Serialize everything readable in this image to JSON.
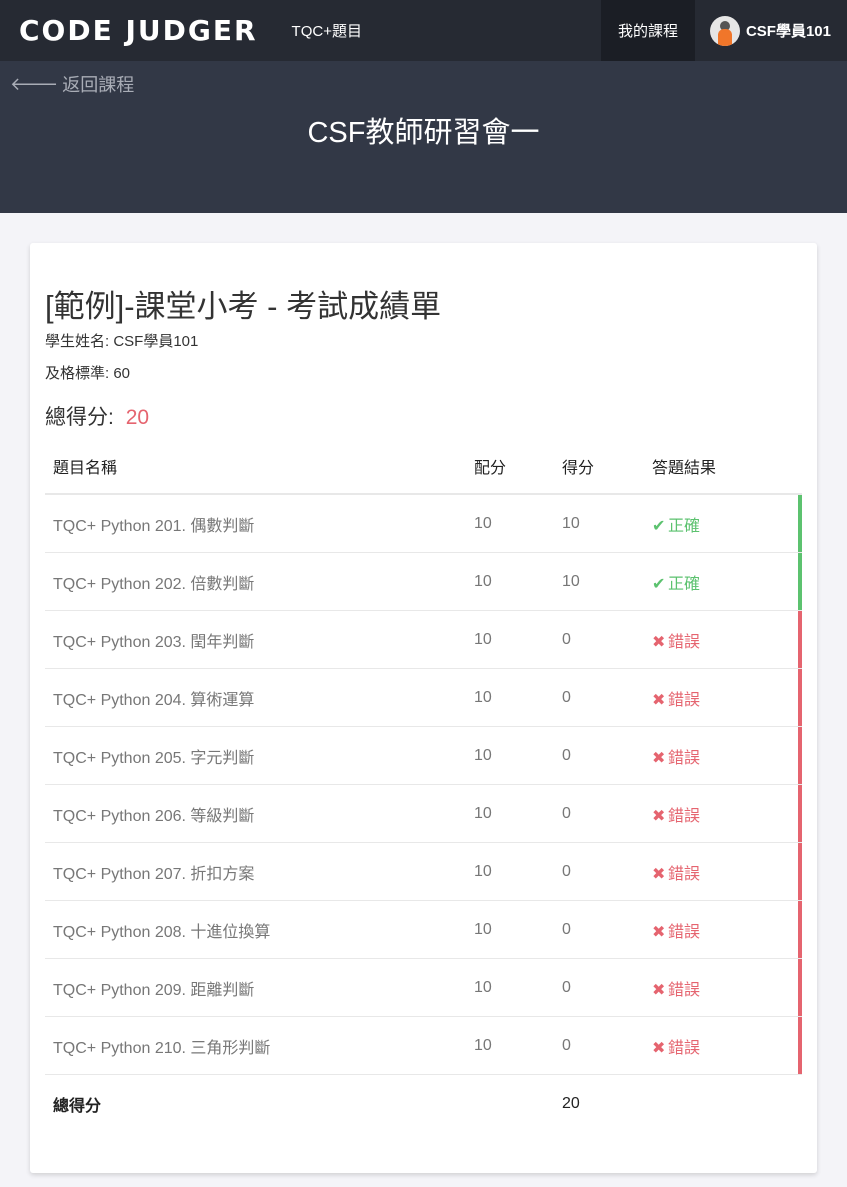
{
  "topbar": {
    "logo": "CODE JUDGER",
    "nav_link": "TQC+題目",
    "my_courses": "我的課程",
    "username": "CSF學員101"
  },
  "header": {
    "back_label": "返回課程",
    "course_title": "CSF教師研習會一"
  },
  "report": {
    "title": "[範例]-課堂小考 - 考試成績單",
    "student_line": "學生姓名: CSF學員101",
    "pass_line": "及格標準: 60",
    "total_label": "總得分:",
    "total_score": "20"
  },
  "table": {
    "headers": [
      "題目名稱",
      "配分",
      "得分",
      "答題結果"
    ],
    "rows": [
      {
        "name": "TQC+ Python 201. 偶數判斷",
        "points": "10",
        "score": "10",
        "result": "正確",
        "status": "ok"
      },
      {
        "name": "TQC+ Python 202. 倍數判斷",
        "points": "10",
        "score": "10",
        "result": "正確",
        "status": "ok"
      },
      {
        "name": "TQC+ Python 203. 閏年判斷",
        "points": "10",
        "score": "0",
        "result": "錯誤",
        "status": "bad"
      },
      {
        "name": "TQC+ Python 204. 算術運算",
        "points": "10",
        "score": "0",
        "result": "錯誤",
        "status": "bad"
      },
      {
        "name": "TQC+ Python 205. 字元判斷",
        "points": "10",
        "score": "0",
        "result": "錯誤",
        "status": "bad"
      },
      {
        "name": "TQC+ Python 206. 等級判斷",
        "points": "10",
        "score": "0",
        "result": "錯誤",
        "status": "bad"
      },
      {
        "name": "TQC+ Python 207. 折扣方案",
        "points": "10",
        "score": "0",
        "result": "錯誤",
        "status": "bad"
      },
      {
        "name": "TQC+ Python 208. 十進位換算",
        "points": "10",
        "score": "0",
        "result": "錯誤",
        "status": "bad"
      },
      {
        "name": "TQC+ Python 209. 距離判斷",
        "points": "10",
        "score": "0",
        "result": "錯誤",
        "status": "bad"
      },
      {
        "name": "TQC+ Python 210. 三角形判斷",
        "points": "10",
        "score": "0",
        "result": "錯誤",
        "status": "bad"
      }
    ],
    "footer_label": "總得分",
    "footer_total": "20"
  },
  "icons": {
    "back": "arrow-left-icon",
    "ok": "check-icon",
    "bad": "cross-icon"
  },
  "colors": {
    "correct": "#5cc26f",
    "wrong": "#e5646f"
  }
}
